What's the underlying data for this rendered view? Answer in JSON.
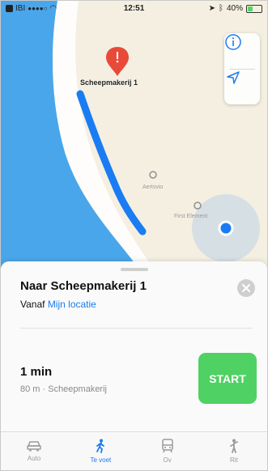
{
  "status_bar": {
    "carrier": "IBI",
    "signal": "●●●●○",
    "time": "12:51",
    "battery_text": "40%",
    "battery_level": 0.4
  },
  "map": {
    "destination_label": "Scheepmakerij 1",
    "poi_1": "Aertsvio",
    "poi_2": "First Element"
  },
  "route_card": {
    "title": "Naar Scheepmakerij 1",
    "from_prefix": "Vanaf",
    "from_location": "Mijn locatie",
    "duration": "1 min",
    "detail": "80 m · Scheepmakerij",
    "start_label": "START"
  },
  "tabs": [
    {
      "label": "Auto",
      "icon": "car-icon"
    },
    {
      "label": "Te voet",
      "icon": "walking-icon"
    },
    {
      "label": "Ov",
      "icon": "bus-icon"
    },
    {
      "label": "Rit",
      "icon": "ride-icon"
    }
  ],
  "colors": {
    "route": "#1a7cf2",
    "water": "#4aa6ea",
    "land": "#f4efe1",
    "start_button": "#4fd163",
    "pin": "#e84a3a"
  }
}
